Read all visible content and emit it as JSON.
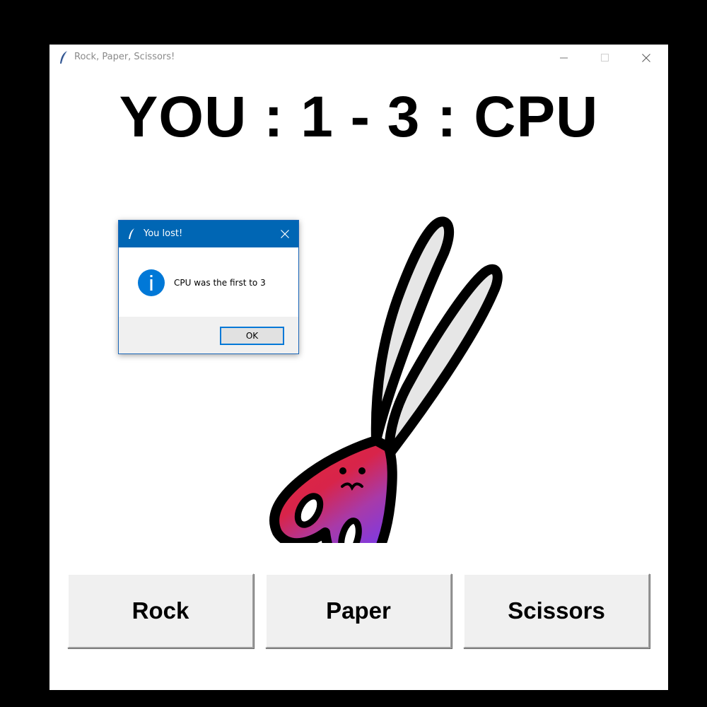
{
  "window": {
    "title": "Rock, Paper, Scissors!"
  },
  "score": {
    "player_label": "YOU",
    "separator1": ":",
    "player_score": "1",
    "dash": "-",
    "cpu_score": "3",
    "separator2": ":",
    "cpu_label": "CPU"
  },
  "display": {
    "current_choice_icon": "scissors-icon"
  },
  "buttons": {
    "rock": "Rock",
    "paper": "Paper",
    "scissors": "Scissors"
  },
  "dialog": {
    "title": "You lost!",
    "message": "CPU was the first to 3",
    "ok_label": "OK",
    "icon": "info-icon"
  },
  "colors": {
    "dialog_titlebar": "#0066b4",
    "info_icon": "#0078d7",
    "button_face": "#f0f0f0"
  }
}
